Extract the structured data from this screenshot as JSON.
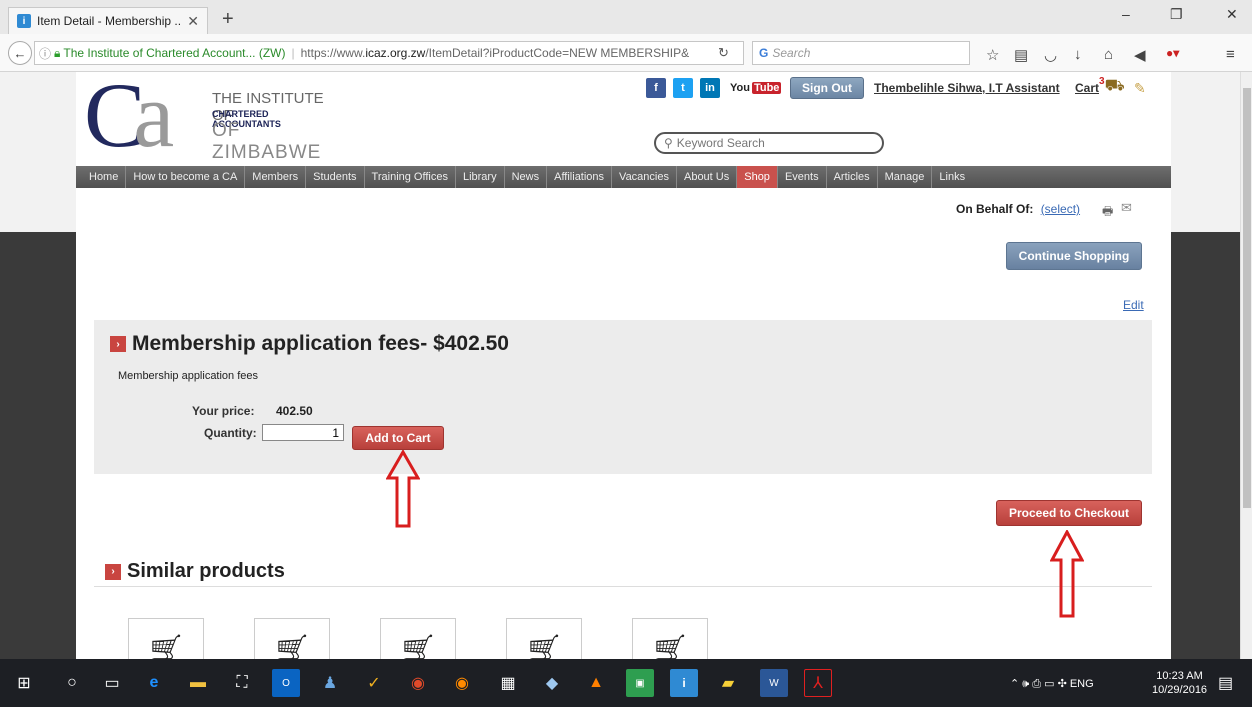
{
  "browser": {
    "tab_title": "Item Detail - Membership ...",
    "tab_close": "✕",
    "new_tab": "+",
    "site_identity": "The Institute of Chartered Account... (ZW)",
    "url_prefix": "https://www.",
    "url_domain": "icaz.org.zw",
    "url_path": "/ItemDetail?iProductCode=NEW MEMBERSHIP&",
    "search_placeholder": "Search",
    "window_minimize": "–",
    "window_maximize": "❐",
    "window_close": "✕"
  },
  "site": {
    "logo_line1": "THE INSTITUTE OF",
    "logo_line2": "CHARTERED ACCOUNTANTS",
    "logo_line3": "OF ZIMBABWE",
    "youtube_you": "You",
    "youtube_tube": "Tube",
    "sign_out": "Sign Out",
    "user_name": "Thembelihle Sihwa, I.T Assistant",
    "cart_label": "Cart",
    "cart_count": "3",
    "keyword_search_placeholder": "Keyword Search",
    "nav_items": [
      "Home",
      "How to become a CA",
      "Members",
      "Students",
      "Training Offices",
      "Library",
      "News",
      "Affiliations",
      "Vacancies",
      "About Us",
      "Shop",
      "Events",
      "Articles",
      "Manage",
      "Links"
    ],
    "nav_active": "Shop",
    "on_behalf_label": "On Behalf Of:",
    "on_behalf_select": "(select)",
    "continue_shopping": "Continue Shopping",
    "edit_link": "Edit"
  },
  "product": {
    "title": "Membership application fees- $402.50",
    "description": "Membership application fees",
    "price_label": "Your price:",
    "price_value": "402.50",
    "quantity_label": "Quantity:",
    "quantity_value": "1",
    "add_to_cart": "Add to Cart",
    "proceed_checkout": "Proceed to Checkout"
  },
  "similar": {
    "title": "Similar products",
    "count": 5
  },
  "taskbar": {
    "language": "ENG",
    "time": "10:23 AM",
    "date": "10/29/2016"
  },
  "colors": {
    "accent_red": "#c94540",
    "nav_gray": "#5a5a5a",
    "button_blue": "#7a93b0",
    "annotation_red": "#d81e1e"
  }
}
